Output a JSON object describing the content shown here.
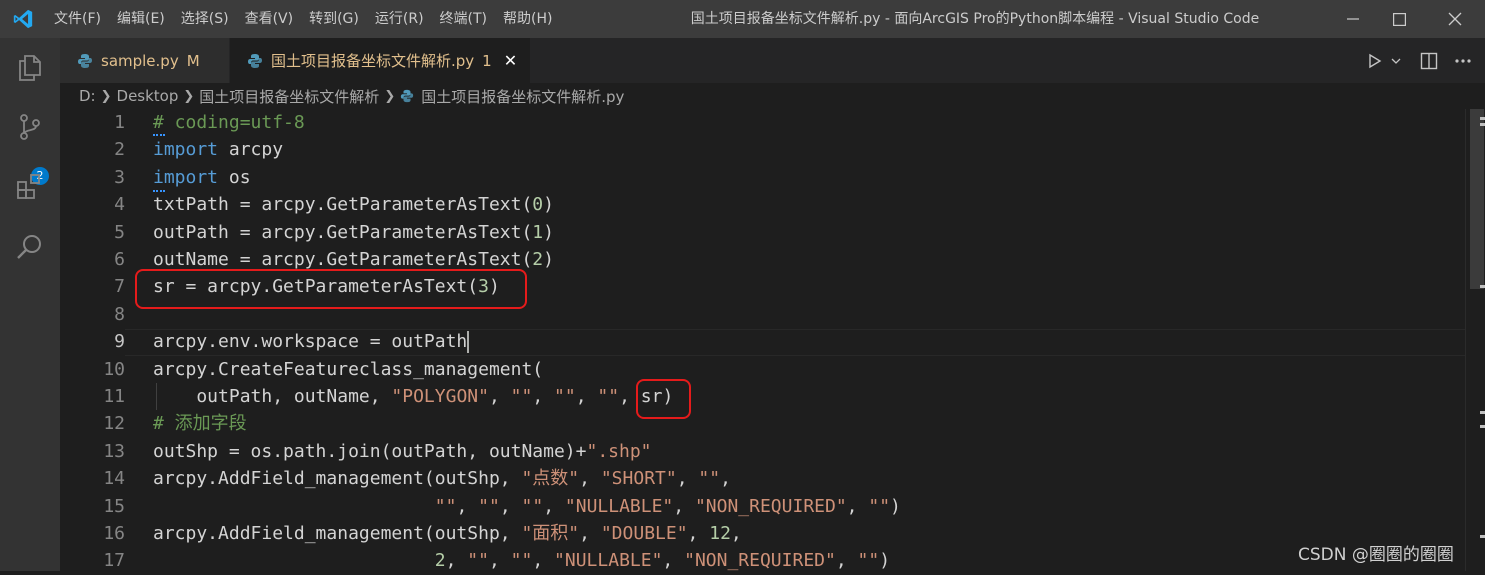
{
  "titlebar": {
    "menu": [
      "文件(F)",
      "编辑(E)",
      "选择(S)",
      "查看(V)",
      "转到(G)",
      "运行(R)",
      "终端(T)",
      "帮助(H)"
    ],
    "title": "国土项目报备坐标文件解析.py - 面向ArcGIS Pro的Python脚本编程 - Visual Studio Code"
  },
  "activitybar": {
    "source_control_badge": "2"
  },
  "tabs": [
    {
      "label": "sample.py",
      "marker": "M"
    },
    {
      "label": "国土项目报备坐标文件解析.py",
      "marker": "1"
    }
  ],
  "breadcrumb": [
    "D:",
    "Desktop",
    "国土项目报备坐标文件解析",
    "国土项目报备坐标文件解析.py"
  ],
  "editor": {
    "line_numbers": [
      "1",
      "2",
      "3",
      "4",
      "5",
      "6",
      "7",
      "8",
      "9",
      "10",
      "11",
      "12",
      "13",
      "14",
      "15",
      "16",
      "17"
    ],
    "active_line": "9",
    "lines": [
      "# coding=utf-8",
      "import arcpy",
      "import os",
      "txtPath = arcpy.GetParameterAsText(0)",
      "outPath = arcpy.GetParameterAsText(1)",
      "outName = arcpy.GetParameterAsText(2)",
      "sr = arcpy.GetParameterAsText(3)",
      "",
      "arcpy.env.workspace = outPath",
      "arcpy.CreateFeatureclass_management(",
      "    outPath, outName, \"POLYGON\", \"\", \"\", \"\", sr)",
      "# 添加字段",
      "outShp = os.path.join(outPath, outName)+\".shp\"",
      "arcpy.AddField_management(outShp, \"点数\", \"SHORT\", \"\",",
      "                          \"\", \"\", \"\", \"NULLABLE\", \"NON_REQUIRED\", \"\")",
      "arcpy.AddField_management(outShp, \"面积\", \"DOUBLE\", 12,",
      "                          2, \"\", \"\", \"NULLABLE\", \"NON_REQUIRED\", \"\")"
    ]
  },
  "icons": {
    "explorer": "files-icon",
    "source_control": "source-control-icon",
    "extensions": "extensions-icon",
    "search": "search-icon"
  },
  "watermark": "CSDN @圈圈的圈圈"
}
